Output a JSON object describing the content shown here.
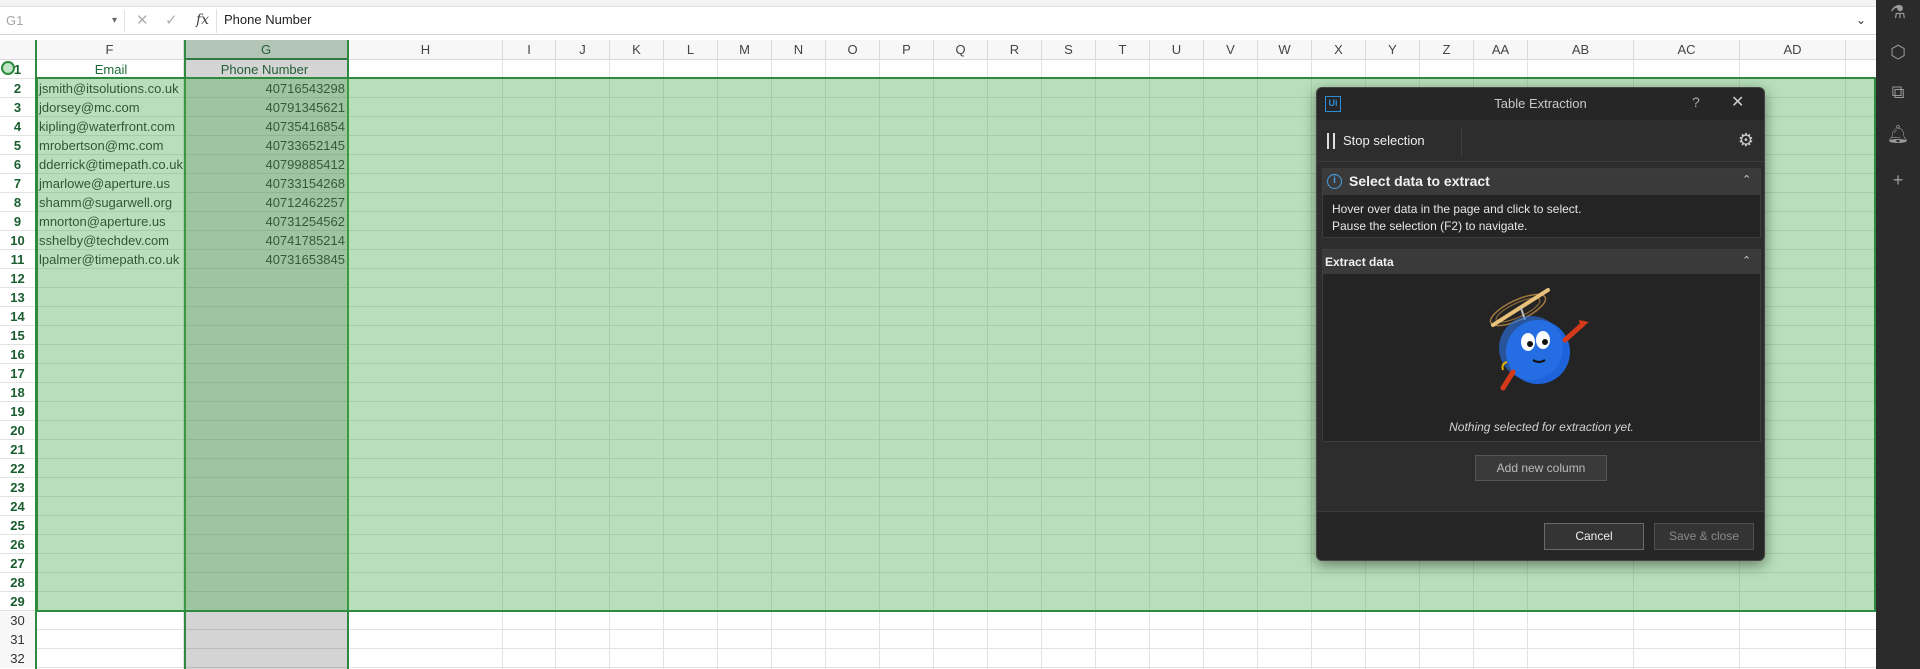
{
  "formula_bar": {
    "name_box": "G1",
    "fx_label": "fx",
    "formula_text": "Phone Number",
    "cancel_glyph": "✕",
    "enter_glyph": "✓"
  },
  "columns": [
    "F",
    "G",
    "H",
    "I",
    "J",
    "K",
    "L",
    "M",
    "N",
    "O",
    "P",
    "Q",
    "R",
    "S",
    "T",
    "U",
    "V",
    "W",
    "X",
    "Y",
    "Z",
    "AA",
    "AB",
    "AC",
    "AD"
  ],
  "header_row": {
    "row": "1",
    "email": "Email",
    "phone": "Phone Number"
  },
  "rows": [
    {
      "num": "2",
      "email": "jsmith@itsolutions.co.uk",
      "phone": "40716543298"
    },
    {
      "num": "3",
      "email": "jdorsey@mc.com",
      "phone": "40791345621"
    },
    {
      "num": "4",
      "email": "kipling@waterfront.com",
      "phone": "40735416854"
    },
    {
      "num": "5",
      "email": "mrobertson@mc.com",
      "phone": "40733652145"
    },
    {
      "num": "6",
      "email": "dderrick@timepath.co.uk",
      "phone": "40799885412"
    },
    {
      "num": "7",
      "email": "jmarlowe@aperture.us",
      "phone": "40733154268"
    },
    {
      "num": "8",
      "email": "shamm@sugarwell.org",
      "phone": "40712462257"
    },
    {
      "num": "9",
      "email": "mnorton@aperture.us",
      "phone": "40731254562"
    },
    {
      "num": "10",
      "email": "sshelby@techdev.com",
      "phone": "40741785214"
    },
    {
      "num": "11",
      "email": "lpalmer@timepath.co.uk",
      "phone": "40731653845"
    }
  ],
  "empty_rows": [
    "12",
    "13",
    "14",
    "15",
    "16",
    "17",
    "18",
    "19",
    "20",
    "21",
    "22",
    "23",
    "24",
    "25",
    "26",
    "27",
    "28",
    "29",
    "30",
    "31",
    "32"
  ],
  "dialog": {
    "logo": "Ui",
    "title": "Table Extraction",
    "help": "?",
    "close": "✕",
    "stop_selection": "Stop selection",
    "section1_title": "Select data to extract",
    "section1_line1": "Hover over data in the page and click to select.",
    "section1_line2": "Pause the selection (F2) to navigate.",
    "section2_title": "Extract data",
    "empty_message": "Nothing selected for extraction yet.",
    "add_column": "Add new column",
    "cancel": "Cancel",
    "save_close": "Save & close"
  },
  "colors": {
    "selection_green": "#4caf50",
    "selection_border": "#2d8a3e",
    "dialog_bg": "#2d2d2d",
    "accent_blue": "#2b8fd6"
  }
}
